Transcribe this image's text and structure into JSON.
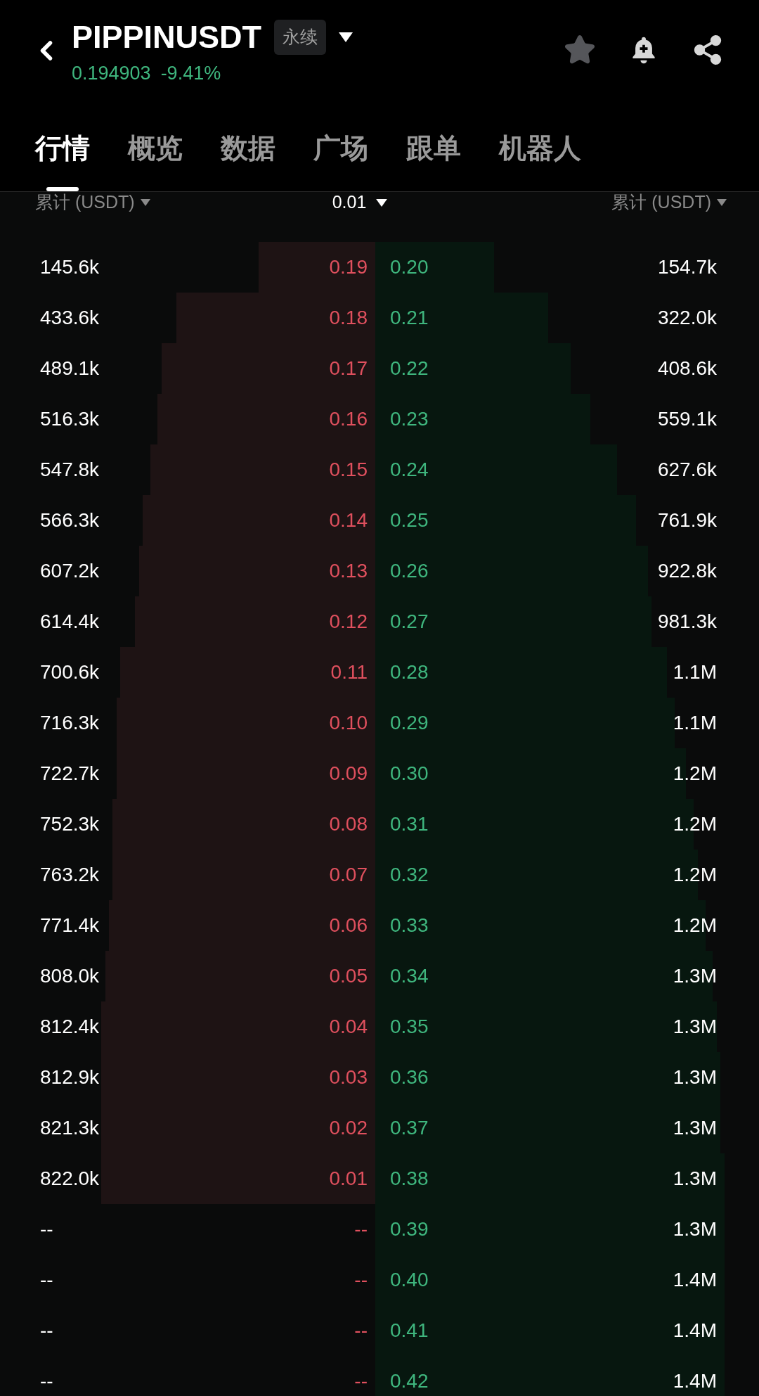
{
  "header": {
    "symbol": "PIPPINUSDT",
    "contract_type": "永续",
    "price": "0.194903",
    "change": "-9.41%"
  },
  "tabs": [
    {
      "label": "行情",
      "selected": true
    },
    {
      "label": "概览",
      "selected": false
    },
    {
      "label": "数据",
      "selected": false
    },
    {
      "label": "广场",
      "selected": false
    },
    {
      "label": "跟单",
      "selected": false
    },
    {
      "label": "机器人",
      "selected": false
    }
  ],
  "columns": {
    "left": "累计 (USDT)",
    "center": "0.01",
    "right": "累计 (USDT)"
  },
  "rows": [
    {
      "left": {
        "total": "145.6k",
        "price": "0.19",
        "level": 0.31
      },
      "right": {
        "price": "0.20",
        "total": "154.7k",
        "level": 0.31
      }
    },
    {
      "left": {
        "total": "433.6k",
        "price": "0.18",
        "level": 0.53
      },
      "right": {
        "price": "0.21",
        "total": "322.0k",
        "level": 0.45
      }
    },
    {
      "left": {
        "total": "489.1k",
        "price": "0.17",
        "level": 0.57
      },
      "right": {
        "price": "0.22",
        "total": "408.6k",
        "level": 0.51
      }
    },
    {
      "left": {
        "total": "516.3k",
        "price": "0.16",
        "level": 0.58
      },
      "right": {
        "price": "0.23",
        "total": "559.1k",
        "level": 0.56
      }
    },
    {
      "left": {
        "total": "547.8k",
        "price": "0.15",
        "level": 0.6
      },
      "right": {
        "price": "0.24",
        "total": "627.6k",
        "level": 0.63
      }
    },
    {
      "left": {
        "total": "566.3k",
        "price": "0.14",
        "level": 0.62
      },
      "right": {
        "price": "0.25",
        "total": "761.9k",
        "level": 0.68
      }
    },
    {
      "left": {
        "total": "607.2k",
        "price": "0.13",
        "level": 0.63
      },
      "right": {
        "price": "0.26",
        "total": "922.8k",
        "level": 0.71
      }
    },
    {
      "left": {
        "total": "614.4k",
        "price": "0.12",
        "level": 0.64
      },
      "right": {
        "price": "0.27",
        "total": "981.3k",
        "level": 0.72
      }
    },
    {
      "left": {
        "total": "700.6k",
        "price": "0.11",
        "level": 0.68
      },
      "right": {
        "price": "0.28",
        "total": "1.1M",
        "level": 0.76
      }
    },
    {
      "left": {
        "total": "716.3k",
        "price": "0.10",
        "level": 0.69
      },
      "right": {
        "price": "0.29",
        "total": "1.1M",
        "level": 0.78
      }
    },
    {
      "left": {
        "total": "722.7k",
        "price": "0.09",
        "level": 0.69
      },
      "right": {
        "price": "0.30",
        "total": "1.2M",
        "level": 0.81
      }
    },
    {
      "left": {
        "total": "752.3k",
        "price": "0.08",
        "level": 0.7
      },
      "right": {
        "price": "0.31",
        "total": "1.2M",
        "level": 0.83
      }
    },
    {
      "left": {
        "total": "763.2k",
        "price": "0.07",
        "level": 0.7
      },
      "right": {
        "price": "0.32",
        "total": "1.2M",
        "level": 0.84
      }
    },
    {
      "left": {
        "total": "771.4k",
        "price": "0.06",
        "level": 0.71
      },
      "right": {
        "price": "0.33",
        "total": "1.2M",
        "level": 0.86
      }
    },
    {
      "left": {
        "total": "808.0k",
        "price": "0.05",
        "level": 0.72
      },
      "right": {
        "price": "0.34",
        "total": "1.3M",
        "level": 0.88
      }
    },
    {
      "left": {
        "total": "812.4k",
        "price": "0.04",
        "level": 0.73
      },
      "right": {
        "price": "0.35",
        "total": "1.3M",
        "level": 0.89
      }
    },
    {
      "left": {
        "total": "812.9k",
        "price": "0.03",
        "level": 0.73
      },
      "right": {
        "price": "0.36",
        "total": "1.3M",
        "level": 0.9
      }
    },
    {
      "left": {
        "total": "821.3k",
        "price": "0.02",
        "level": 0.73
      },
      "right": {
        "price": "0.37",
        "total": "1.3M",
        "level": 0.9
      }
    },
    {
      "left": {
        "total": "822.0k",
        "price": "0.01",
        "level": 0.73
      },
      "right": {
        "price": "0.38",
        "total": "1.3M",
        "level": 0.91
      }
    },
    {
      "left": {
        "total": "--",
        "price": "--"
      },
      "right": {
        "price": "0.39",
        "total": "1.3M",
        "level": 0.91
      }
    },
    {
      "left": {
        "total": "--",
        "price": "--"
      },
      "right": {
        "price": "0.40",
        "total": "1.4M",
        "level": 0.91
      }
    },
    {
      "left": {
        "total": "--",
        "price": "--"
      },
      "right": {
        "price": "0.41",
        "total": "1.4M",
        "level": 0.91
      }
    },
    {
      "left": {
        "total": "--",
        "price": "--"
      },
      "right": {
        "price": "0.42",
        "total": "1.4M",
        "level": 0.91
      }
    }
  ]
}
